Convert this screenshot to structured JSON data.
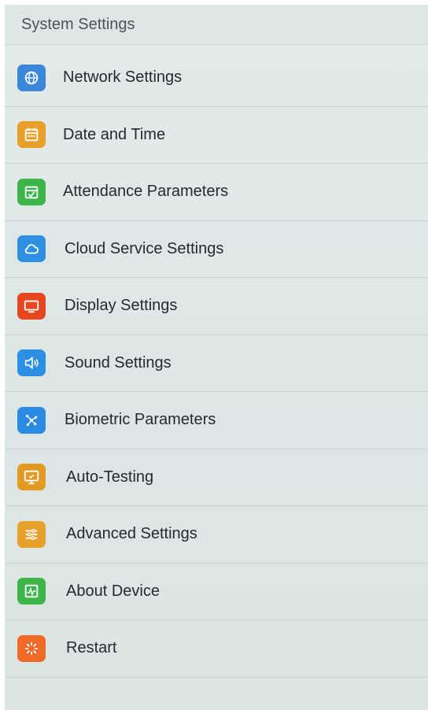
{
  "header": {
    "title": "System Settings"
  },
  "items": [
    {
      "label": "Network Settings",
      "icon": "network-globe-icon",
      "color": "#3a86d9"
    },
    {
      "label": "Date and Time",
      "icon": "calendar-icon",
      "color": "#e8a02c"
    },
    {
      "label": "Attendance Parameters",
      "icon": "calendar-check-icon",
      "color": "#3db54a"
    },
    {
      "label": "Cloud Service Settings",
      "icon": "cloud-icon",
      "color": "#2f8fe0"
    },
    {
      "label": "Display Settings",
      "icon": "monitor-icon",
      "color": "#e5471f"
    },
    {
      "label": "Sound Settings",
      "icon": "speaker-icon",
      "color": "#2d8fe3"
    },
    {
      "label": "Biometric Parameters",
      "icon": "biometric-icon",
      "color": "#2b8be2"
    },
    {
      "label": "Auto-Testing",
      "icon": "monitor-check-icon",
      "color": "#e39a25"
    },
    {
      "label": "Advanced Settings",
      "icon": "sliders-icon",
      "color": "#e8a02c"
    },
    {
      "label": "About Device",
      "icon": "device-info-icon",
      "color": "#3db54a"
    },
    {
      "label": "Restart",
      "icon": "restart-icon",
      "color": "#ef6a27"
    }
  ]
}
